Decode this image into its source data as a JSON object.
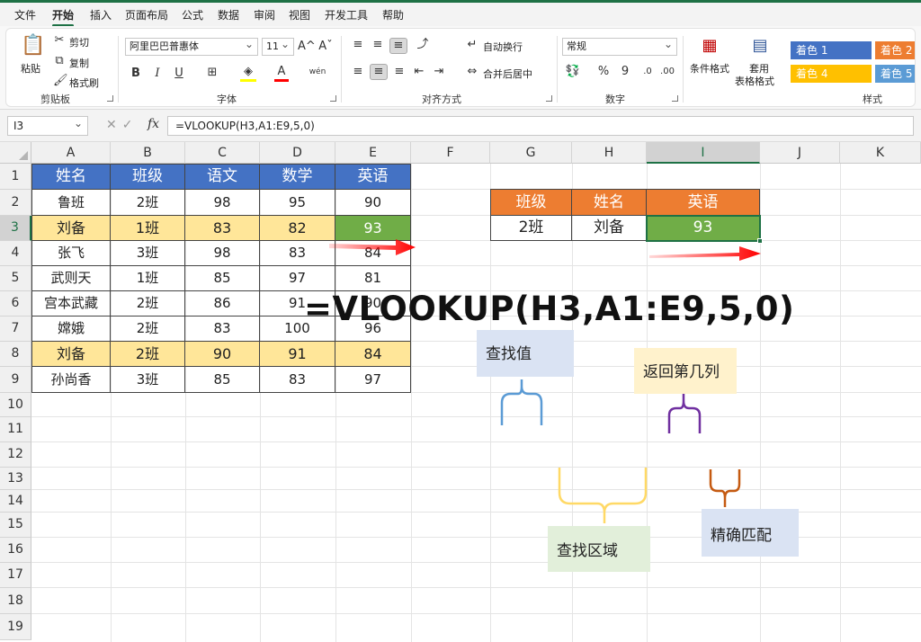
{
  "menu": {
    "tabs": [
      "文件",
      "开始",
      "插入",
      "页面布局",
      "公式",
      "数据",
      "审阅",
      "视图",
      "开发工具",
      "帮助"
    ],
    "active": "开始"
  },
  "ribbon": {
    "clipboard": {
      "paste": "粘贴",
      "cut": "剪切",
      "copy": "复制",
      "format_painter": "格式刷",
      "label": "剪贴板"
    },
    "font": {
      "family": "阿里巴巴普惠体",
      "size": "11",
      "grow": "A^",
      "shrink": "Aˇ",
      "bold": "B",
      "italic": "I",
      "underline": "U",
      "font_color": "A",
      "phonetic": "wén",
      "label": "字体"
    },
    "alignment": {
      "wrap_text": "自动换行",
      "merge_center": "合并后居中",
      "label": "对齐方式"
    },
    "number": {
      "format": "常规",
      "percent": "%",
      "comma": "9",
      "label": "数字"
    },
    "styles": {
      "conditional": "条件格式",
      "table_format_line1": "套用",
      "table_format_line2": "表格格式",
      "swatches": [
        {
          "label": "着色 1",
          "color": "#4472c4"
        },
        {
          "label": "着色 2",
          "color": "#ed7d31"
        },
        {
          "label": "着色 4",
          "color": "#ffc000"
        },
        {
          "label": "着色 5",
          "color": "#5b9bd5"
        }
      ],
      "label": "样式"
    }
  },
  "formula_bar": {
    "name_box": "I3",
    "fx": "fx",
    "formula": "=VLOOKUP(H3,A1:E9,5,0)"
  },
  "columns": [
    "A",
    "B",
    "C",
    "D",
    "E",
    "F",
    "G",
    "H",
    "I",
    "J",
    "K"
  ],
  "selected_column": "I",
  "rows": [
    "1",
    "2",
    "3",
    "4",
    "5",
    "6",
    "7",
    "8",
    "9",
    "10",
    "11",
    "12",
    "13",
    "14",
    "15",
    "16",
    "17",
    "18",
    "19"
  ],
  "selected_row": "3",
  "table": {
    "header": [
      "姓名",
      "班级",
      "语文",
      "数学",
      "英语"
    ],
    "rows": [
      [
        "鲁班",
        "2班",
        "98",
        "95",
        "90"
      ],
      [
        "刘备",
        "1班",
        "83",
        "82",
        "93"
      ],
      [
        "张飞",
        "3班",
        "98",
        "83",
        "84"
      ],
      [
        "武则天",
        "1班",
        "85",
        "97",
        "81"
      ],
      [
        "宫本武藏",
        "2班",
        "86",
        "91",
        "90"
      ],
      [
        "嫦娥",
        "2班",
        "83",
        "100",
        "96"
      ],
      [
        "刘备",
        "2班",
        "90",
        "91",
        "84"
      ],
      [
        "孙尚香",
        "3班",
        "85",
        "83",
        "97"
      ]
    ]
  },
  "result_table": {
    "header": [
      "班级",
      "姓名",
      "英语"
    ],
    "row": [
      "2班",
      "刘备",
      "93"
    ]
  },
  "annotation": {
    "formula": "=VLOOKUP(H3,A1:E9,5,0)",
    "lookup_value": "查找值",
    "column_index": "返回第几列",
    "lookup_range": "查找区域",
    "exact_match": "精确匹配"
  },
  "colors": {
    "header_blue": "#4472c4",
    "header_orange": "#ed7d31",
    "highlight_yellow": "#ffe699",
    "green": "#70ad47",
    "arrow_red": "#ff0000"
  }
}
